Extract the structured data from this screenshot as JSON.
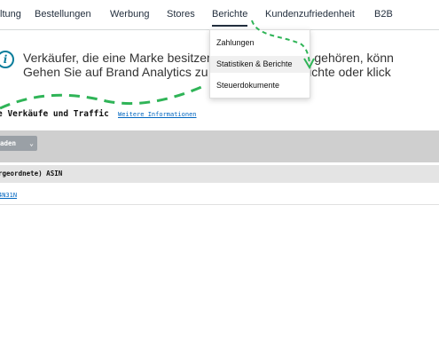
{
  "navbar": {
    "items": [
      {
        "label": "ltung"
      },
      {
        "label": "Bestellungen"
      },
      {
        "label": "Werbung"
      },
      {
        "label": "Stores"
      },
      {
        "label": "Berichte"
      },
      {
        "label": "Kundenzufriedenheit"
      },
      {
        "label": "B2B"
      }
    ],
    "active": "Berichte"
  },
  "banner": {
    "line1": "Verkäufer, die eine Marke besitzen oder einer Marke gehören, könn",
    "line2": "Gehen Sie auf Brand Analytics zu diesem Menü Berichte oder klick"
  },
  "dropdown": {
    "items": [
      {
        "label": "Zahlungen"
      },
      {
        "label": "Statistiken & Berichte"
      },
      {
        "label": "Steuerdokumente"
      }
    ],
    "highlighted": "Statistiken & Berichte"
  },
  "section": {
    "title": "e Verkäufe und Traffic",
    "more_link": "Weitere Informationen"
  },
  "filter": {
    "selected": "aden"
  },
  "table": {
    "header": "rgeordnete) ASIN",
    "rows": [
      {
        "asin": "4N31N"
      }
    ]
  },
  "colors": {
    "annotation_arrow": "#2fb457",
    "link": "#0066c0",
    "info_icon": "#0a7d9b"
  }
}
